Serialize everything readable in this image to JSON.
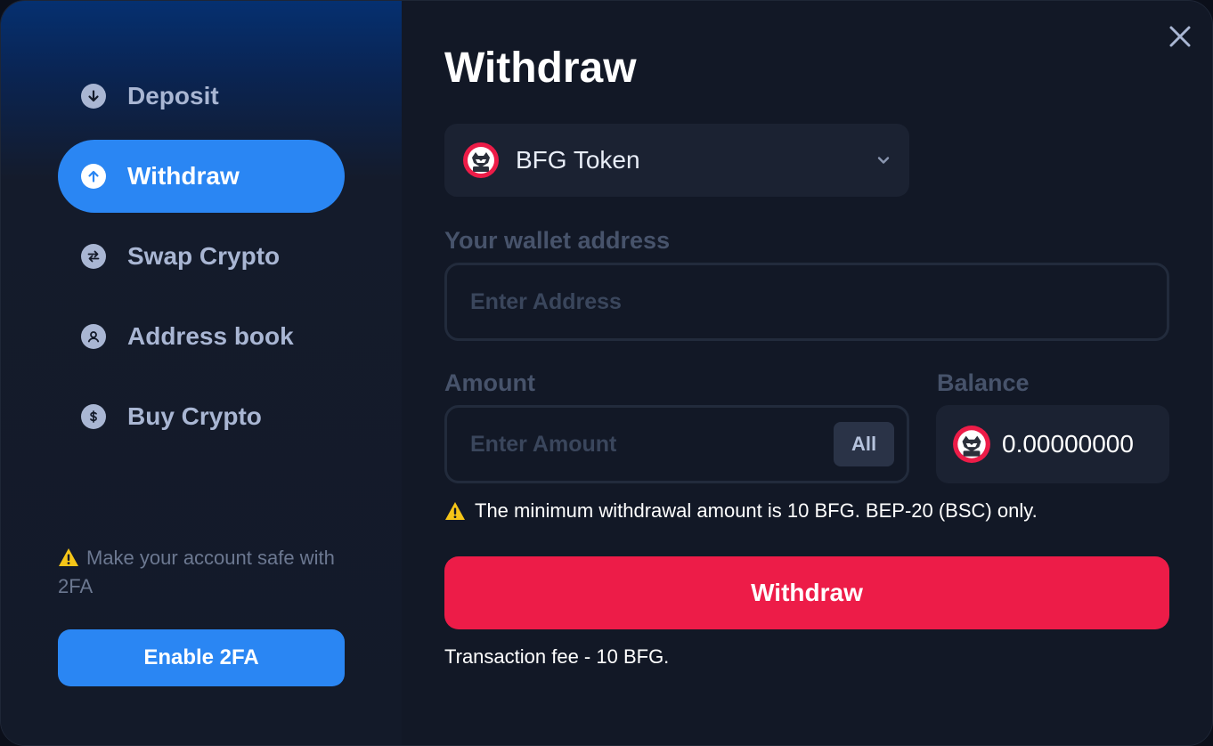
{
  "sidebar": {
    "items": [
      {
        "label": "Deposit",
        "icon": "arrow-down-circle-icon",
        "active": false
      },
      {
        "label": "Withdraw",
        "icon": "arrow-up-circle-icon",
        "active": true
      },
      {
        "label": "Swap Crypto",
        "icon": "swap-arrows-icon",
        "active": false
      },
      {
        "label": "Address book",
        "icon": "user-circle-icon",
        "active": false
      },
      {
        "label": "Buy Crypto",
        "icon": "dollar-circle-icon",
        "active": false
      }
    ],
    "security_note": "Make your account safe with 2FA",
    "enable_2fa_label": "Enable 2FA"
  },
  "main": {
    "title": "Withdraw",
    "token_select": {
      "selected": "BFG Token",
      "icon": "bfg-token-logo"
    },
    "wallet": {
      "label": "Your wallet address",
      "placeholder": "Enter Address",
      "value": ""
    },
    "amount": {
      "label": "Amount",
      "placeholder": "Enter Amount",
      "value": "",
      "all_label": "All"
    },
    "balance": {
      "label": "Balance",
      "value": "0.00000000"
    },
    "notice": "The minimum withdrawal amount is 10 BFG. BEP-20 (BSC) only.",
    "submit_label": "Withdraw",
    "fee_text": "Transaction fee - 10 BFG."
  },
  "colors": {
    "accent_blue": "#2a86f3",
    "danger_red": "#ed1c48",
    "warning_yellow": "#f5c518",
    "panel_bg": "#121826"
  }
}
